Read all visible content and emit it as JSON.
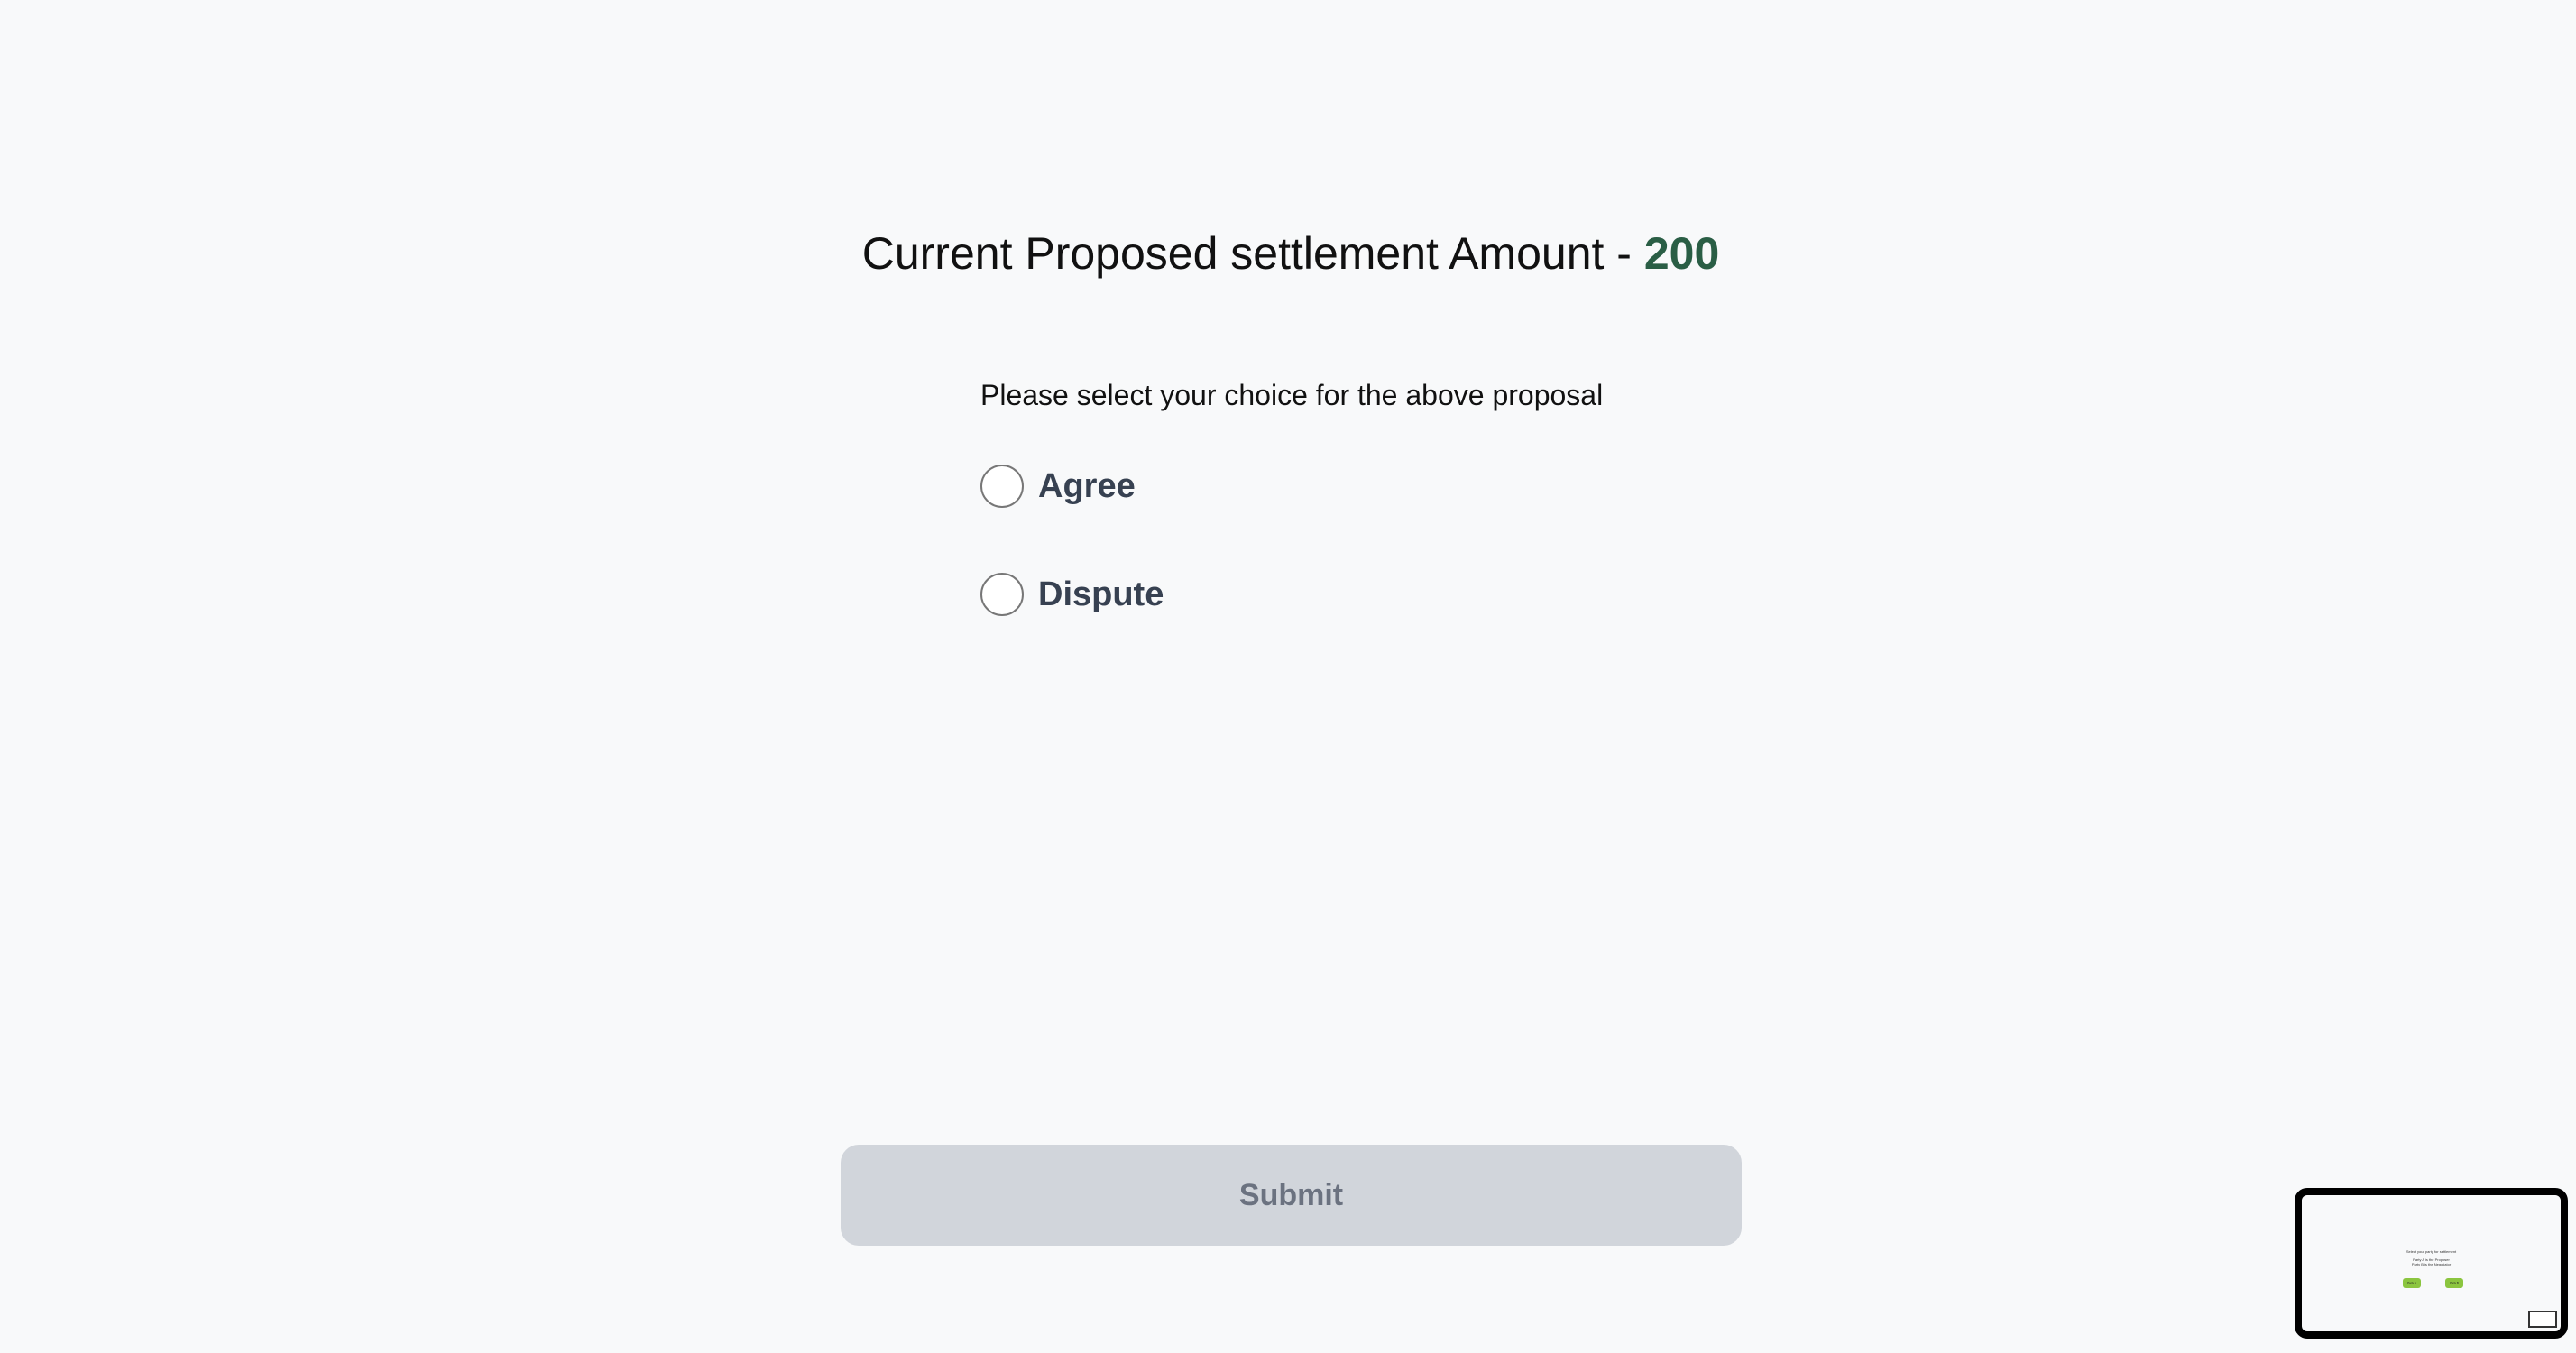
{
  "header": {
    "title_prefix": "Current Proposed settlement Amount - ",
    "amount": "200"
  },
  "form": {
    "prompt": "Please select your choice for the above proposal",
    "options": [
      {
        "label": "Agree",
        "selected": false
      },
      {
        "label": "Dispute",
        "selected": false
      }
    ],
    "submit_label": "Submit"
  },
  "thumbnail": {
    "title": "Select your party for settlement",
    "line1": "Party A is the Proposer",
    "line2": "Party B is the Negotiator",
    "button_a": "Party A",
    "button_b": "Party B"
  },
  "colors": {
    "amount": "#2a5e45",
    "submit_bg": "#d1d5db",
    "thumb_button": "#8bc53f"
  }
}
